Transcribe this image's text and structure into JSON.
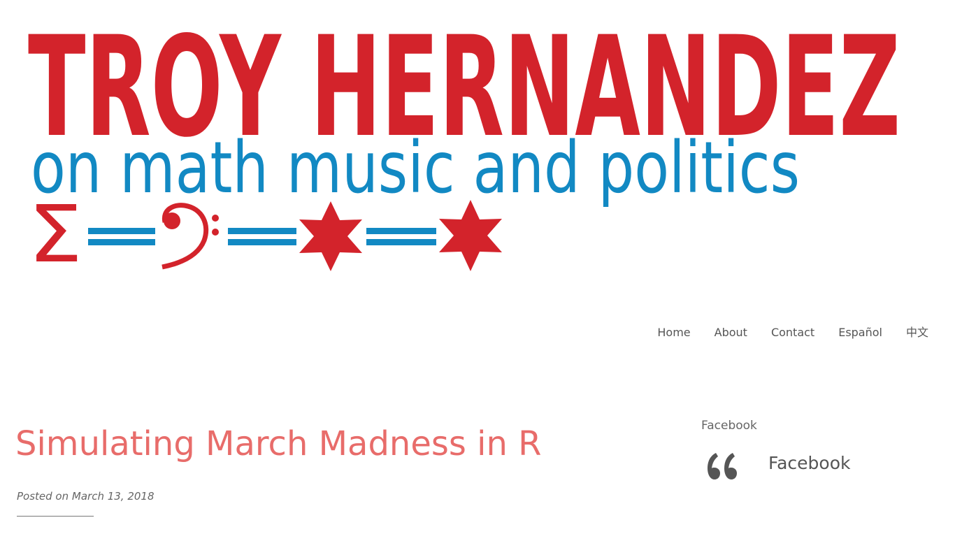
{
  "header": {
    "logo_title": "TROY HERNANDEZ",
    "logo_tagline": "on math music and politics",
    "logo_sigma": "Σ",
    "logo_clef": "𝄢",
    "logo_colors": {
      "red": "#d3232b",
      "blue": "#1289c3"
    }
  },
  "nav": {
    "items": [
      {
        "label": "Home"
      },
      {
        "label": "About"
      },
      {
        "label": "Contact"
      },
      {
        "label": "Español"
      },
      {
        "label": "中文"
      }
    ]
  },
  "post": {
    "title": "Simulating March Madness in R",
    "meta_prefix": "Posted on ",
    "date": "March 13, 2018",
    "title_color": "#e86c6a"
  },
  "sidebar": {
    "widget_title": "Facebook",
    "quote_icon": "quote-left-icon",
    "widget_link": "Facebook"
  }
}
